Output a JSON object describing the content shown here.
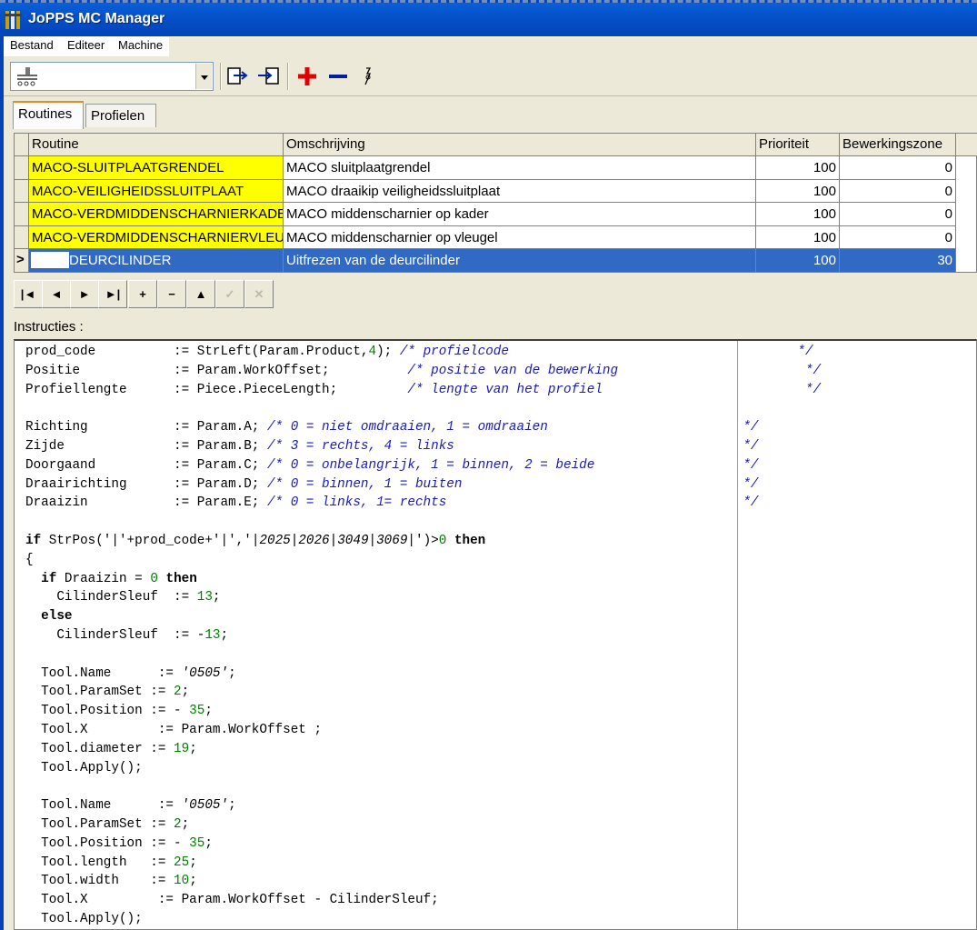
{
  "window": {
    "title": "JoPPS MC Manager"
  },
  "menu": [
    "Bestand",
    "Editeer",
    "Machine"
  ],
  "toolbar": {
    "combo_icon": "machine-icon",
    "icons": [
      "export-icon",
      "import-icon",
      "add-icon",
      "remove-icon",
      "info-icon"
    ]
  },
  "tabs": [
    "Routines",
    "Profielen"
  ],
  "grid": {
    "columns": [
      "Routine",
      "Omschrijving",
      "Prioriteit",
      "Bewerkingszone"
    ],
    "rows": [
      {
        "routine": "MACO-SLUITPLAATGRENDEL",
        "omschrijving": "MACO sluitplaatgrendel",
        "prioriteit": "100",
        "zone": "0"
      },
      {
        "routine": "MACO-VEILIGHEIDSSLUITPLAAT",
        "omschrijving": "MACO draaikip veiligheidssluitplaat",
        "prioriteit": "100",
        "zone": "0"
      },
      {
        "routine": "MACO-VERDMIDDENSCHARNIERKADER",
        "omschrijving": "MACO middenscharnier op kader",
        "prioriteit": "100",
        "zone": "0"
      },
      {
        "routine": "MACO-VERDMIDDENSCHARNIERVLEUGEL",
        "omschrijving": "MACO middenscharnier op vleugel",
        "prioriteit": "100",
        "zone": "0"
      },
      {
        "routine": "DEURCILINDER",
        "omschrijving": "Uitfrezen van de deurcilinder",
        "prioriteit": "100",
        "zone": "30"
      }
    ],
    "selected_marker": ">"
  },
  "navigator": [
    "|◄",
    "◄",
    "►",
    "►|",
    "+",
    "−",
    "▲",
    "✓",
    "✕"
  ],
  "instructions_label": "Instructies :",
  "code_lines": [
    [
      [
        "prod_code          := StrLeft(Param.Product,",
        ""
      ],
      [
        "4",
        "nm"
      ],
      [
        "); ",
        ""
      ],
      [
        "/* profielcode                                     */",
        "cm"
      ]
    ],
    [
      [
        "Positie            := Param.WorkOffset;          ",
        ""
      ],
      [
        "/* positie van de bewerking                        */",
        "cm"
      ]
    ],
    [
      [
        "Profiellengte      := Piece.PieceLength;         ",
        ""
      ],
      [
        "/* lengte van het profiel                          */",
        "cm"
      ]
    ],
    [
      [
        "",
        ""
      ]
    ],
    [
      [
        "Richting           := Param.A; ",
        ""
      ],
      [
        "/* 0 = niet omdraaien, 1 = omdraaien                         */",
        "cm"
      ]
    ],
    [
      [
        "Zijde              := Param.B; ",
        ""
      ],
      [
        "/* 3 = rechts, 4 = links                                     */",
        "cm"
      ]
    ],
    [
      [
        "Doorgaand          := Param.C; ",
        ""
      ],
      [
        "/* 0 = onbelangrijk, 1 = binnen, 2 = beide                   */",
        "cm"
      ]
    ],
    [
      [
        "Draairichting      := Param.D; ",
        ""
      ],
      [
        "/* 0 = binnen, 1 = buiten                                    */",
        "cm"
      ]
    ],
    [
      [
        "Draaizin           := Param.E; ",
        ""
      ],
      [
        "/* 0 = links, 1= rechts                                      */",
        "cm"
      ]
    ],
    [
      [
        "",
        ""
      ]
    ],
    [
      [
        "if",
        "kw"
      ],
      [
        " StrPos('|'+prod_code+'|','",
        ""
      ],
      [
        "|2025|2026|3049|3069|",
        "st"
      ],
      [
        "')>",
        ""
      ],
      [
        "0",
        "nm"
      ],
      [
        " ",
        ""
      ],
      [
        "then",
        "kw"
      ]
    ],
    [
      [
        "{",
        ""
      ]
    ],
    [
      [
        "  ",
        ""
      ],
      [
        "if",
        "kw"
      ],
      [
        " Draaizin = ",
        ""
      ],
      [
        "0",
        "nm"
      ],
      [
        " ",
        ""
      ],
      [
        "then",
        "kw"
      ]
    ],
    [
      [
        "    CilinderSleuf  := ",
        ""
      ],
      [
        "13",
        "nm"
      ],
      [
        ";",
        ""
      ]
    ],
    [
      [
        "  ",
        ""
      ],
      [
        "else",
        "kw"
      ]
    ],
    [
      [
        "    CilinderSleuf  := -",
        ""
      ],
      [
        "13",
        "nm"
      ],
      [
        ";",
        ""
      ]
    ],
    [
      [
        "",
        ""
      ]
    ],
    [
      [
        "  Tool.Name      := ",
        ""
      ],
      [
        "'0505'",
        "st"
      ],
      [
        ";",
        ""
      ]
    ],
    [
      [
        "  Tool.ParamSet := ",
        ""
      ],
      [
        "2",
        "nm"
      ],
      [
        ";",
        ""
      ]
    ],
    [
      [
        "  Tool.Position := - ",
        ""
      ],
      [
        "35",
        "nm"
      ],
      [
        ";",
        ""
      ]
    ],
    [
      [
        "  Tool.X         := Param.WorkOffset ;",
        ""
      ]
    ],
    [
      [
        "  Tool.diameter := ",
        ""
      ],
      [
        "19",
        "nm"
      ],
      [
        ";",
        ""
      ]
    ],
    [
      [
        "  Tool.Apply();",
        ""
      ]
    ],
    [
      [
        "",
        ""
      ]
    ],
    [
      [
        "  Tool.Name      := ",
        ""
      ],
      [
        "'0505'",
        "st"
      ],
      [
        ";",
        ""
      ]
    ],
    [
      [
        "  Tool.ParamSet := ",
        ""
      ],
      [
        "2",
        "nm"
      ],
      [
        ";",
        ""
      ]
    ],
    [
      [
        "  Tool.Position := - ",
        ""
      ],
      [
        "35",
        "nm"
      ],
      [
        ";",
        ""
      ]
    ],
    [
      [
        "  Tool.length   := ",
        ""
      ],
      [
        "25",
        "nm"
      ],
      [
        ";",
        ""
      ]
    ],
    [
      [
        "  Tool.width    := ",
        ""
      ],
      [
        "10",
        "nm"
      ],
      [
        ";",
        ""
      ]
    ],
    [
      [
        "  Tool.X         := Param.WorkOffset - CilinderSleuf;",
        ""
      ]
    ],
    [
      [
        "  Tool.Apply();",
        ""
      ]
    ]
  ]
}
